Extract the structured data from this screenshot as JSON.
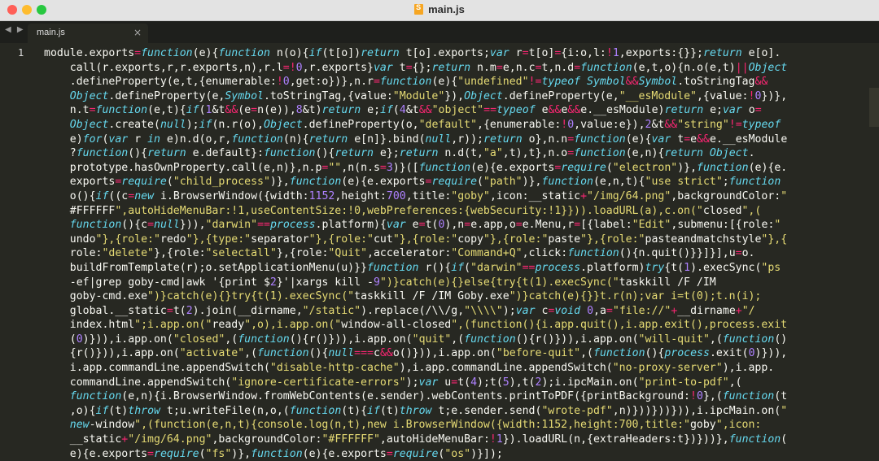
{
  "window": {
    "title": "main.js"
  },
  "tabs": [
    {
      "label": "main.js",
      "close_icon": "×"
    }
  ],
  "nav": {
    "arrows": "◀ ▶"
  },
  "editor": {
    "line_number": "1",
    "code_lines": [
      "module.exports=function(e){function n(o){if(t[o])return t[o].exports;var r=t[o]={i:o,l:!1,exports:{}};return e[o].",
      "    call(r.exports,r,r.exports,n),r.l=!0,r.exports}var t={};return n.m=e,n.c=t,n.d=function(e,t,o){n.o(e,t)||Object",
      "    .defineProperty(e,t,{enumerable:!0,get:o})},n.r=function(e){\"undefined\"!=typeof Symbol&&Symbol.toStringTag&&",
      "    Object.defineProperty(e,Symbol.toStringTag,{value:\"Module\"}),Object.defineProperty(e,\"__esModule\",{value:!0})},",
      "    n.t=function(e,t){if(1&t&&(e=n(e)),8&t)return e;if(4&t&&\"object\"==typeof e&&e&&e.__esModule)return e;var o=",
      "    Object.create(null);if(n.r(o),Object.defineProperty(o,\"default\",{enumerable:!0,value:e}),2&t&&\"string\"!=typeof",
      "    e)for(var r in e)n.d(o,r,function(n){return e[n]}.bind(null,r));return o},n.n=function(e){var t=e&&e.__esModule",
      "    ?function(){return e.default}:function(){return e};return n.d(t,\"a\",t),t},n.o=function(e,n){return Object.",
      "    prototype.hasOwnProperty.call(e,n)},n.p=\"\",n(n.s=3)}([function(e){e.exports=require(\"electron\")},function(e){e.",
      "    exports=require(\"child_process\")},function(e){e.exports=require(\"path\")},function(e,n,t){\"use strict\";function",
      "    o(){if((c=new i.BrowserWindow({width:1152,height:700,title:\"goby\",icon:__static+\"/img/64.png\",backgroundColor:\"",
      "    #FFFFFF\",autoHideMenuBar:!1,useContentSize:!0,webPreferences:{webSecurity:!1}})).loadURL(a),c.on(\"closed\",(",
      "    function(){c=null})),\"darwin\"==process.platform){var e=t(0),n=e.app,o=e.Menu,r=[{label:\"Edit\",submenu:[{role:\"",
      "    undo\"},{role:\"redo\"},{type:\"separator\"},{role:\"cut\"},{role:\"copy\"},{role:\"paste\"},{role:\"pasteandmatchstyle\"},{",
      "    role:\"delete\"},{role:\"selectall\"},{role:\"Quit\",accelerator:\"Command+Q\",click:function(){n.quit()}}]}],u=o.",
      "    buildFromTemplate(r);o.setApplicationMenu(u)}}function r(){if(\"darwin\"==process.platform)try{t(1).execSync(\"ps",
      "    -ef|grep goby-cmd|awk '{print $2}'|xargs kill -9\")}catch(e){}else{try{t(1).execSync(\"taskkill /F /IM",
      "    goby-cmd.exe\")}catch(e){}try{t(1).execSync(\"taskkill /F /IM Goby.exe\")}catch(e){}}t.r(n);var i=t(0);t.n(i);",
      "    global.__static=t(2).join(__dirname,\"/static\").replace(/\\\\/g,\"\\\\\\\\\");var c=void 0,a=\"file://\"+__dirname+\"/",
      "    index.html\";i.app.on(\"ready\",o),i.app.on(\"window-all-closed\",(function(){i.app.quit(),i.app.exit(),process.exit",
      "    (0)})),i.app.on(\"closed\",(function(){r()})),i.app.on(\"quit\",(function(){r()})),i.app.on(\"will-quit\",(function()",
      "    {r()})),i.app.on(\"activate\",(function(){null===c&&o()})),i.app.on(\"before-quit\",(function(){process.exit(0)})),",
      "    i.app.commandLine.appendSwitch(\"disable-http-cache\"),i.app.commandLine.appendSwitch(\"no-proxy-server\"),i.app.",
      "    commandLine.appendSwitch(\"ignore-certificate-errors\");var u=t(4);t(5),t(2);i.ipcMain.on(\"print-to-pdf\",(",
      "    function(e,n){i.BrowserWindow.fromWebContents(e.sender).webContents.printToPDF({printBackground:!0},(function(t",
      "    ,o){if(t)throw t;u.writeFile(n,o,(function(t){if(t)throw t;e.sender.send(\"wrote-pdf\",n)}))}))})),i.ipcMain.on(\"",
      "    new-window\",(function(e,n,t){console.log(n,t),new i.BrowserWindow({width:1152,height:700,title:\"goby\",icon:",
      "    __static+\"/img/64.png\",backgroundColor:\"#FFFFFF\",autoHideMenuBar:!1}).loadURL(n,{extraHeaders:t})}))},function(",
      "    e){e.exports=require(\"fs\")},function(e){e.exports=require(\"os\")}]);"
    ]
  },
  "colors": {
    "background": "#272822",
    "text": "#f8f8f2",
    "keyword": "#66d9ef",
    "string": "#e6db74",
    "number": "#ae81ff",
    "operator": "#f92672"
  }
}
